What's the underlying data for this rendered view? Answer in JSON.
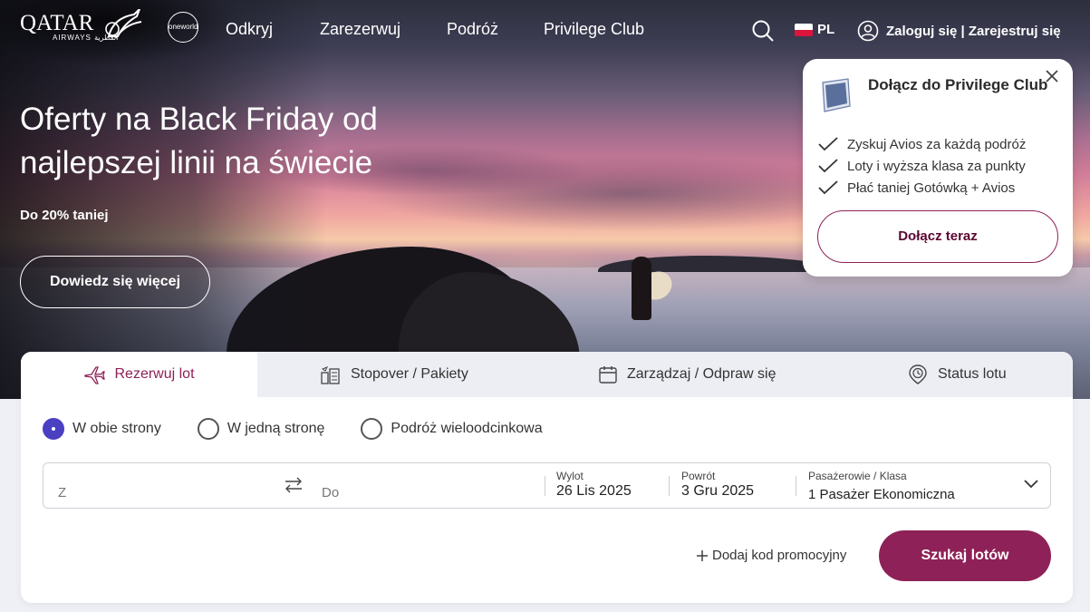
{
  "brand": {
    "name": "QATAR",
    "sub": "AIRWAYS القطرية",
    "alliance": "oneworld",
    "accent": "#8e2157",
    "radio_accent": "#4b3fc2"
  },
  "nav": {
    "links": [
      "Odkryj",
      "Zarezerwuj",
      "Podróż",
      "Privilege Club"
    ],
    "search_icon": "search-icon",
    "language": "PL",
    "login": "Zaloguj się | Zarejestruj się"
  },
  "hero": {
    "title": "Oferty na Black Friday od najlepszej linii na świecie",
    "subtitle": "Do 20% taniej",
    "cta": "Dowiedz się więcej"
  },
  "popup": {
    "title": "Dołącz do Privilege Club",
    "badge": "avios",
    "benefits": [
      "Zyskuj Avios za każdą podróż",
      "Loty i wyższa klasa za punkty",
      "Płać taniej Gotówką + Avios"
    ],
    "cta": "Dołącz teraz"
  },
  "booking": {
    "tabs": [
      "Rezerwuj lot",
      "Stopover / Pakiety",
      "Zarządzaj / Odpraw się",
      "Status lotu"
    ],
    "active_tab": "Rezerwuj lot",
    "trip_types": [
      "W obie strony",
      "W jedną stronę",
      "Podróż wieloodcinkowa"
    ],
    "selected_trip": "W obie strony",
    "from_placeholder": "Z",
    "to_placeholder": "Do",
    "depart_label": "Wylot",
    "depart_value": "26 Lis 2025",
    "return_label": "Powrót",
    "return_value": "3 Gru 2025",
    "pax_label": "Pasażerowie / Klasa",
    "pax_value": "1  Pasażer Ekonomiczna",
    "promo": "Dodaj kod promocyjny",
    "search": "Szukaj lotów"
  }
}
